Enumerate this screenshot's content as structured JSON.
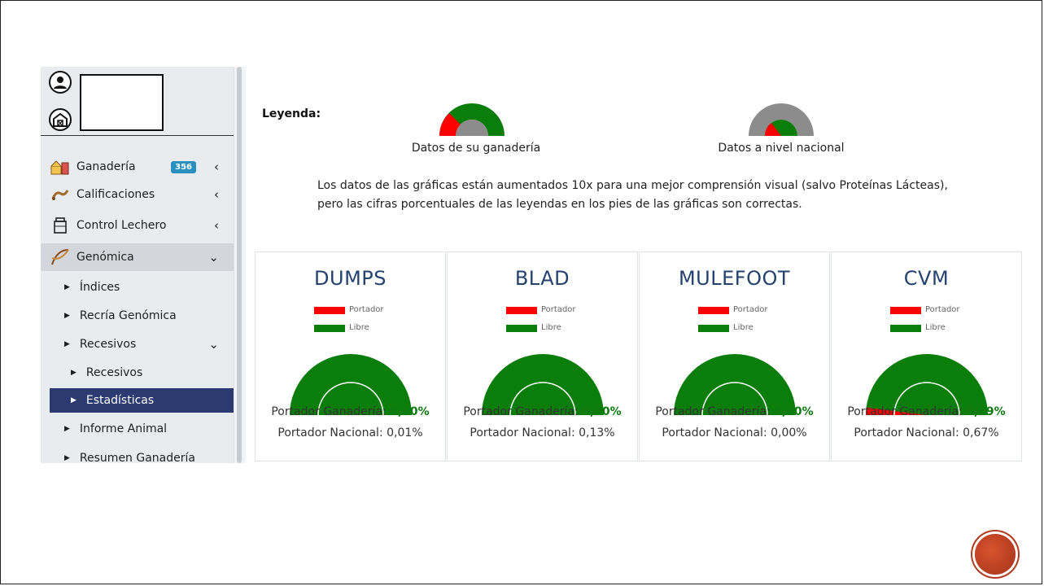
{
  "sidebar": {
    "items": [
      {
        "label": "Ganadería",
        "badge": "356",
        "chevron": "‹"
      },
      {
        "label": "Calificaciones",
        "chevron": "‹"
      },
      {
        "label": "Control Lechero",
        "chevron": "‹"
      },
      {
        "label": "Genómica",
        "chevron": "⌄"
      }
    ],
    "genomica_sub": [
      {
        "label": "Índices"
      },
      {
        "label": "Recría Genómica"
      },
      {
        "label": "Recesivos",
        "chevron": "⌄"
      }
    ],
    "recesivos_sub": [
      {
        "label": "Recesivos"
      },
      {
        "label": "Estadísticas"
      }
    ],
    "more_sub": [
      {
        "label": "Informe Animal"
      },
      {
        "label": "Resumen Ganadería"
      }
    ]
  },
  "legend": {
    "title": "Leyenda:",
    "farm_caption": "Datos de su ganadería",
    "national_caption": "Datos a nivel nacional"
  },
  "note": {
    "line1": "Los datos de las gráficas están aumentados 10x para una mejor comprensión visual (salvo Proteínas Lácteas),",
    "line2": "pero las cifras porcentuales de las leyendas en los pies de las gráficas son correctas."
  },
  "series_labels": {
    "carrier": "Portador",
    "free": "Libre"
  },
  "colors": {
    "carrier": "#ff0000",
    "free": "#0a7d0a",
    "national_bg": "#8c8c8c",
    "selected_nav": "#2b3a70"
  },
  "cards": [
    {
      "title": "DUMPS",
      "farm_prefix": "Portador Ganadería: ",
      "farm_pct": "0,00%",
      "national": "Portador Nacional: 0,01%"
    },
    {
      "title": "BLAD",
      "farm_prefix": "Portador Ganadería: ",
      "farm_pct": "0,00%",
      "national": "Portador Nacional: 0,13%"
    },
    {
      "title": "MULEFOOT",
      "farm_prefix": "Portador Ganadería: ",
      "farm_pct": "0,00%",
      "national": "Portador Nacional: 0,00%"
    },
    {
      "title": "CVM",
      "farm_prefix": "Portador Ganadería: ",
      "farm_pct": "0,39%",
      "national": "Portador Nacional: 0,67%"
    }
  ]
}
